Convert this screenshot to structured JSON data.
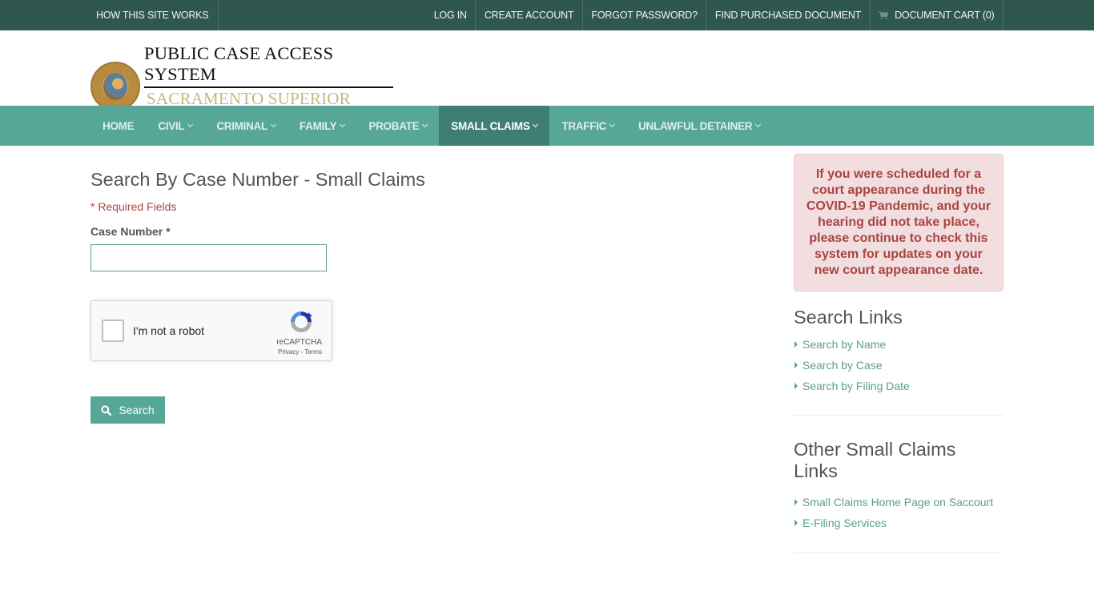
{
  "topbar": {
    "left_links": [
      "HOW THIS SITE WORKS"
    ],
    "right_links": [
      "LOG IN",
      "CREATE ACCOUNT",
      "FORGOT PASSWORD?",
      "FIND PURCHASED DOCUMENT"
    ],
    "cart": {
      "icon": "shopping-cart-icon",
      "label": "DOCUMENT CART (0)"
    }
  },
  "header": {
    "logo_icon": "court-seal",
    "title": "PUBLIC CASE ACCESS SYSTEM",
    "subtitle": "SACRAMENTO SUPERIOR COURT"
  },
  "nav": {
    "items": [
      {
        "label": "HOME",
        "dropdown": false,
        "active": false
      },
      {
        "label": "CIVIL",
        "dropdown": true,
        "active": false
      },
      {
        "label": "CRIMINAL",
        "dropdown": true,
        "active": false
      },
      {
        "label": "FAMILY",
        "dropdown": true,
        "active": false
      },
      {
        "label": "PROBATE",
        "dropdown": true,
        "active": false
      },
      {
        "label": "SMALL CLAIMS",
        "dropdown": true,
        "active": true
      },
      {
        "label": "TRAFFIC",
        "dropdown": true,
        "active": false
      },
      {
        "label": "UNLAWFUL DETAINER",
        "dropdown": true,
        "active": false
      }
    ]
  },
  "main": {
    "title": "Search By Case Number - Small Claims",
    "required_note": "* Required Fields",
    "case_number_label": "Case Number *",
    "case_number_value": "",
    "recaptcha": {
      "label": "I'm not a robot",
      "brand": "reCAPTCHA",
      "links": "Privacy - Terms",
      "checked": false
    },
    "search_button": {
      "icon": "search-icon",
      "label": "Search"
    }
  },
  "sidebar": {
    "alert": "If you were scheduled for a court appearance during the COVID-19 Pandemic, and your hearing did not take place, please continue to check this system for updates on your new court appearance date.",
    "search_links": {
      "heading": "Search Links",
      "items": [
        "Search by Name",
        "Search by Case",
        "Search by Filing Date"
      ]
    },
    "other_links": {
      "heading": "Other Small Claims Links",
      "items": [
        "Small Claims Home Page on Saccourt",
        "E-Filing Services"
      ]
    }
  },
  "colors": {
    "topbar_bg": "#2f574f",
    "nav_bg": "#57a799",
    "nav_active_bg": "#3f7f73",
    "link": "#5b9e94",
    "alert_bg": "#f2dede",
    "alert_text": "#a94442",
    "logo_subtitle": "#c9b77f"
  }
}
